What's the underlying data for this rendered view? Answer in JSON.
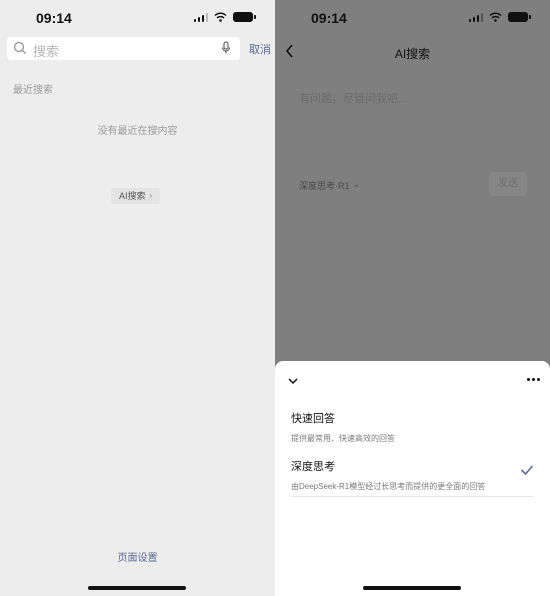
{
  "left": {
    "status": {
      "time": "09:14"
    },
    "search": {
      "placeholder": "搜索"
    },
    "cancel_label": "取消",
    "recent_label": "最近搜索",
    "empty_hint": "没有最近在搜内容",
    "ai_chip": {
      "label": "AI搜索",
      "chevron": "›"
    },
    "page_settings_label": "页面设置"
  },
  "right": {
    "status": {
      "time": "09:14"
    },
    "nav": {
      "title": "AI搜索"
    },
    "ask_hint": "有问题，尽管问我吧…",
    "mode_row": {
      "label": "深度思考·R1",
      "chevron": "⌄"
    },
    "send_label": "发送",
    "sheet": {
      "options": [
        {
          "title": "快速回答",
          "desc": "提供最常用、快速高效的回答",
          "selected": false
        },
        {
          "title": "深度思考",
          "desc": "由DeepSeek-R1模型经过长思考而提供的更全面的回答",
          "selected": true
        }
      ]
    }
  },
  "colors": {
    "accent_link": "#576b95",
    "check": "#576b95"
  },
  "icons": [
    "search-icon",
    "mic-icon",
    "back-icon",
    "chevron-down-icon",
    "more-icon",
    "check-icon",
    "wifi-icon",
    "battery-icon",
    "signal-icon"
  ]
}
